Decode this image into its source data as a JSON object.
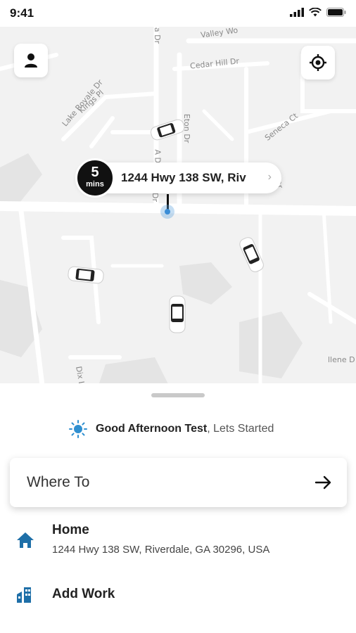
{
  "status_bar": {
    "time": "9:41"
  },
  "map": {
    "street_labels": [
      "Valley Wo",
      "Cedar Hill Dr",
      "Lake Royale Dr",
      "Kings Pl",
      "Eton Dr",
      "Seneca Ct",
      "Dix L",
      "llene D",
      "a Dr",
      "A Dr",
      "Dr",
      "B Dr"
    ],
    "eta": {
      "value": "5",
      "unit": "mins",
      "address": "1244 Hwy 138 SW, Riv"
    }
  },
  "greeting": {
    "name": "Good Afternoon Test",
    "suffix": ", Lets Started"
  },
  "search": {
    "label": "Where To"
  },
  "saved_places": [
    {
      "title": "Home",
      "address": "1244 Hwy 138 SW, Riverdale, GA 30296, USA"
    },
    {
      "title": "Add Work"
    }
  ],
  "colors": {
    "accent": "#2f8fd0",
    "home_icon": "#1e6fa8",
    "pin": "#3a8dd6"
  }
}
